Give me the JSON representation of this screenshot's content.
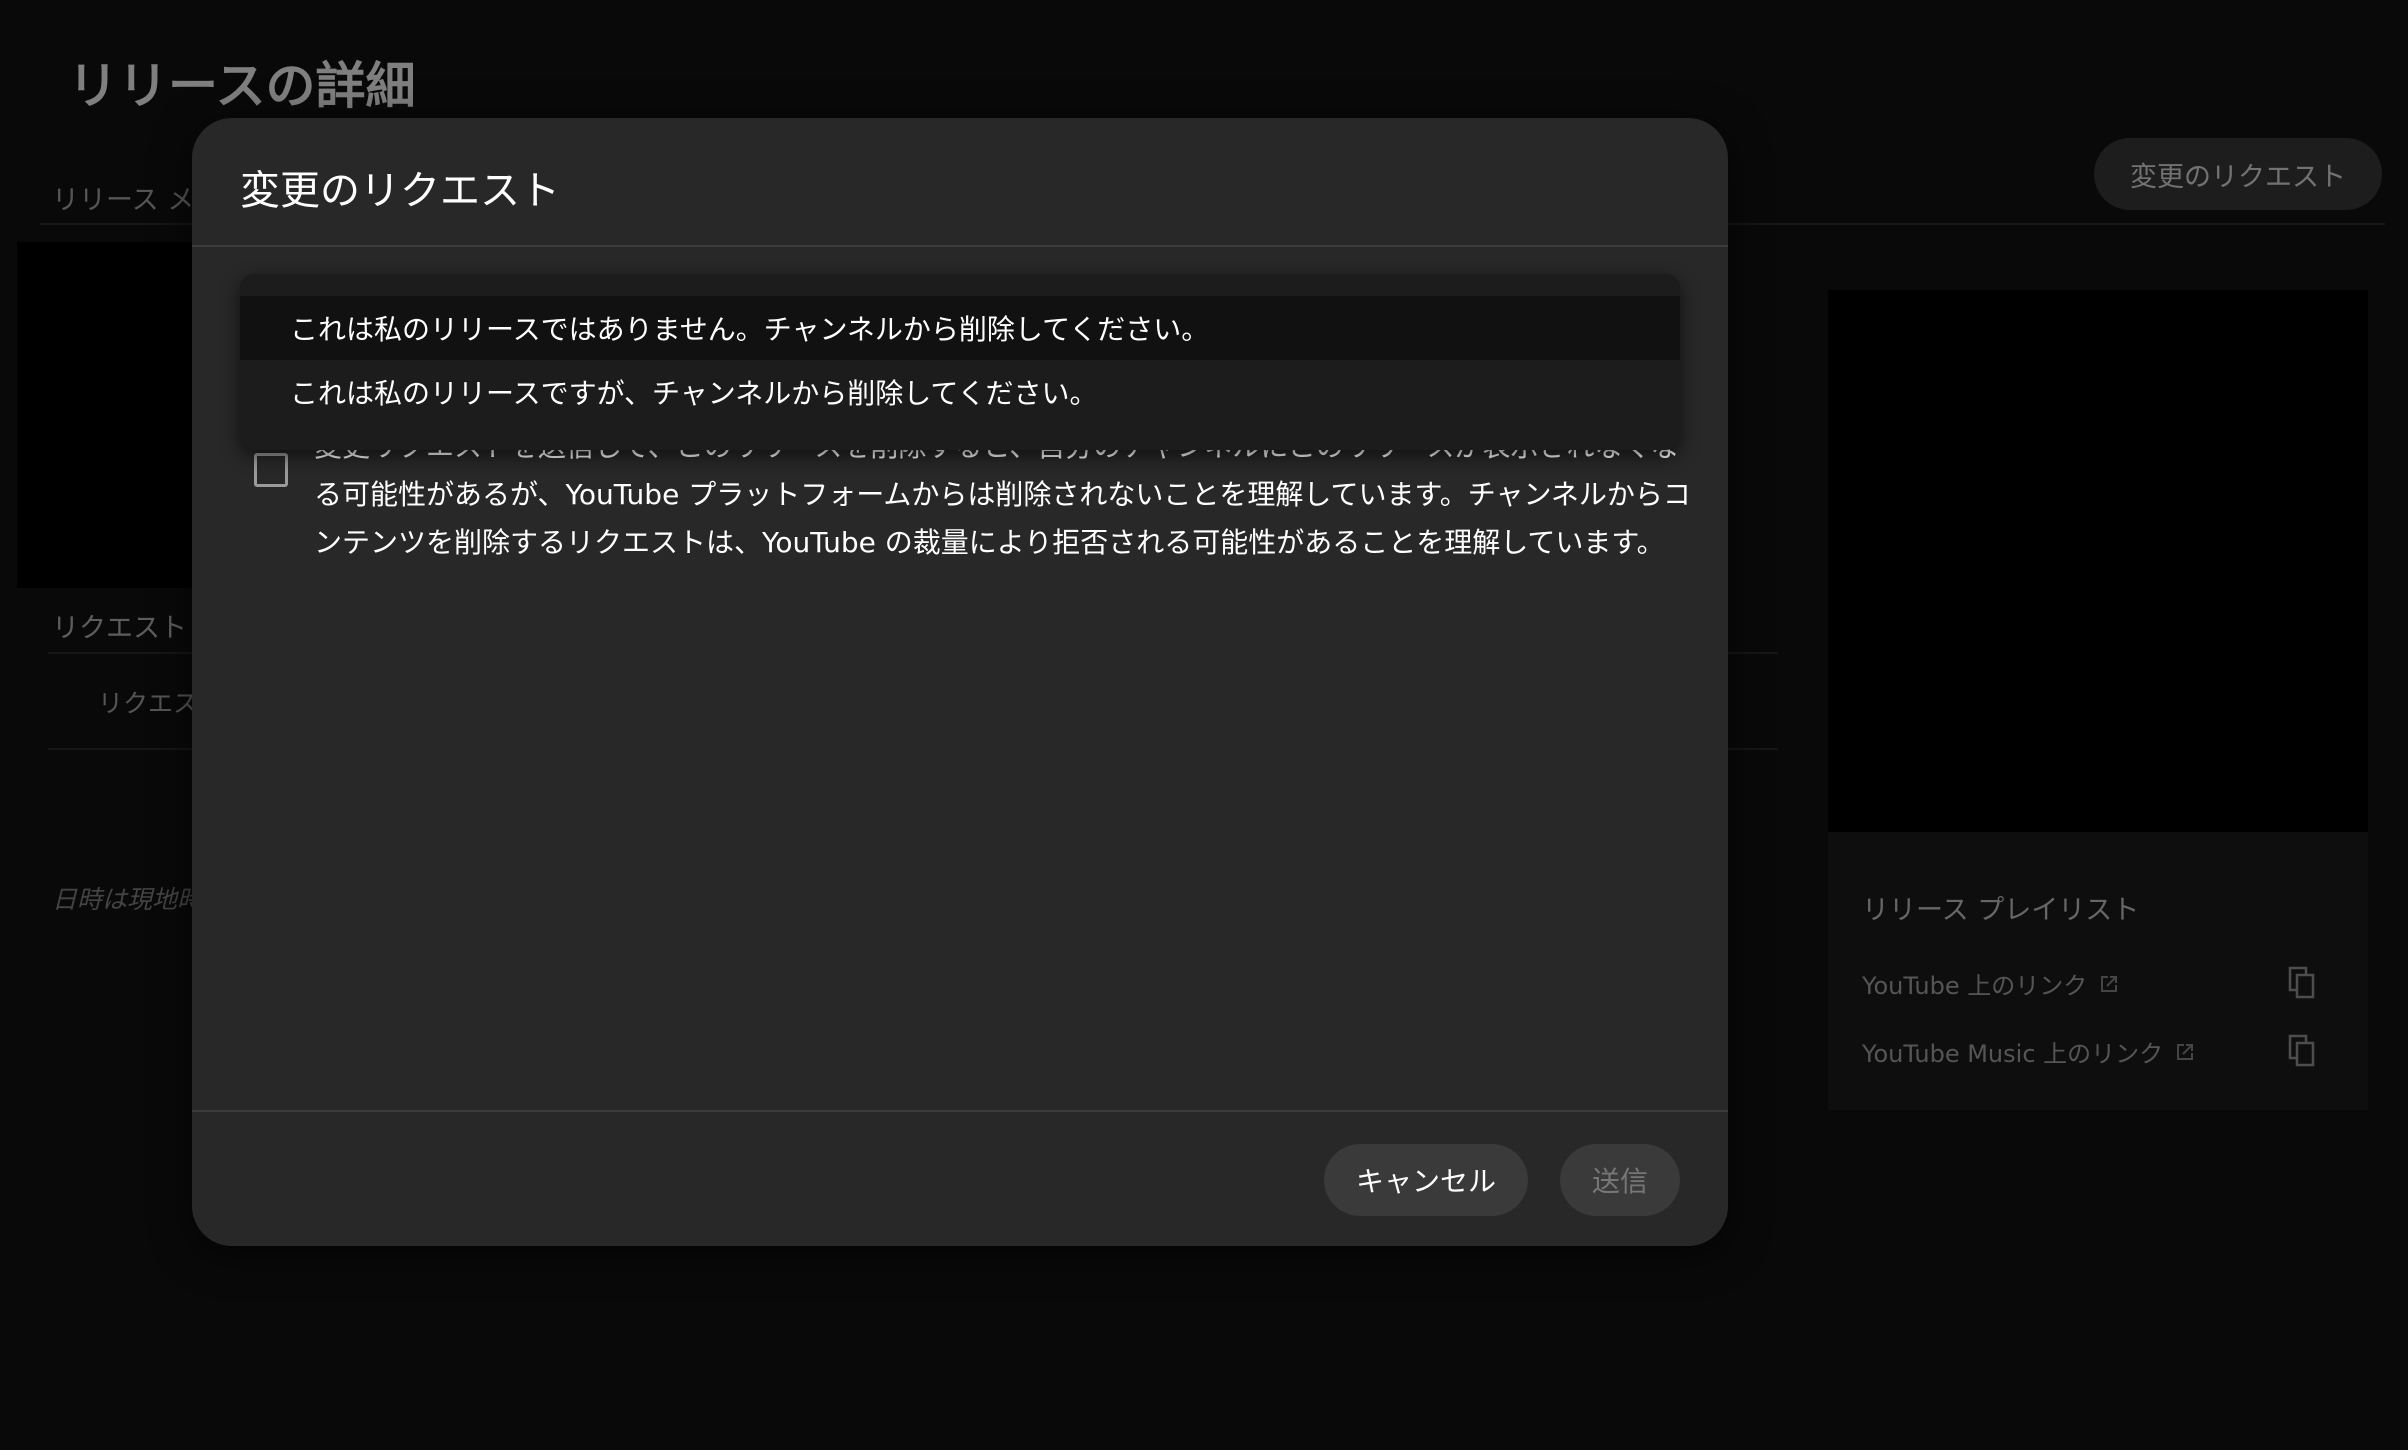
{
  "background": {
    "page_title": "リリースの詳細",
    "tab_label": "リリース メタ",
    "request_change_button": "変更のリクエスト",
    "requests_heading": "リクエスト",
    "request_row": "リクエスト",
    "timezone_note": "日時は現地時",
    "playlist_heading": "リリース プレイリスト",
    "links": [
      {
        "label": "YouTube 上のリンク"
      },
      {
        "label": "YouTube Music 上のリンク"
      }
    ]
  },
  "dialog": {
    "title": "変更のリクエスト",
    "dropdown_options": [
      "これは私のリリースではありません。チャンネルから削除してください。",
      "これは私のリリースですが、チャンネルから削除してください。"
    ],
    "checkbox_label": "変更リクエストを送信して、このリリースを削除すると、自分のチャンネルにこのリリースが表示されなくなる可能性があるが、YouTube プラットフォームからは削除されないことを理解しています。チャンネルからコンテンツを削除するリクエストは、YouTube の裁量により拒否される可能性があることを理解しています。",
    "cancel_button": "キャンセル",
    "submit_button": "送信"
  }
}
